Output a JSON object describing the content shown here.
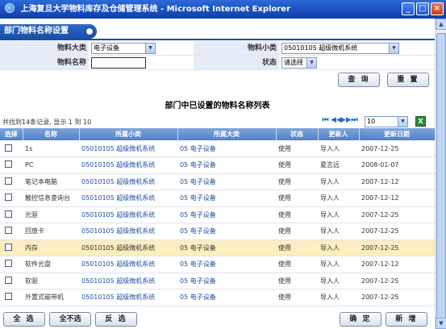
{
  "window": {
    "title": "上海复旦大学物料库存及仓储管理系统 - Microsoft Internet Explorer",
    "minimize": "_",
    "restore": "□",
    "close": "×"
  },
  "section": {
    "title": "部门物料名称设置"
  },
  "filter": {
    "category_label": "物料大类",
    "category_value": "电子设备",
    "subcategory_label": "物料小类",
    "subcategory_value": "05010105 超级微机系统",
    "name_label": "物料名称",
    "name_value": "",
    "status_label": "状态",
    "status_value": "请选择"
  },
  "buttons": {
    "query": "查 询",
    "reset": "重 置",
    "select_all": "全 选",
    "select_none": "全不选",
    "invert": "反 选",
    "confirm": "确 定",
    "add": "新 增"
  },
  "list": {
    "title": "部门中已设置的物料名称列表"
  },
  "pager": {
    "info": "共找到14条记录, 显示 1 到 10",
    "page_size": "10",
    "first": "⏮",
    "prev": "◀◀",
    "next": "▶▶",
    "last": "⏭",
    "export": "X"
  },
  "table": {
    "headers": [
      "选择",
      "名称",
      "所属小类",
      "所属大类",
      "状态",
      "更新人",
      "更新日期"
    ],
    "rows": [
      {
        "name": "1s",
        "sub": "05010105 超级微机系统",
        "cat": "05 电子设备",
        "status": "使用",
        "user": "导入人",
        "date": "2007-12-25"
      },
      {
        "name": "PC",
        "sub": "05010105 超级微机系统",
        "cat": "05 电子设备",
        "status": "使用",
        "user": "夏志远",
        "date": "2008-01-07"
      },
      {
        "name": "笔记本电脑",
        "sub": "05010105 超级微机系统",
        "cat": "05 电子设备",
        "status": "使用",
        "user": "导入人",
        "date": "2007-12-12"
      },
      {
        "name": "触控信息查询台",
        "sub": "05010105 超级微机系统",
        "cat": "05 电子设备",
        "status": "使用",
        "user": "导入人",
        "date": "2007-12-12"
      },
      {
        "name": "光驱",
        "sub": "05010105 超级微机系统",
        "cat": "05 电子设备",
        "status": "使用",
        "user": "导入人",
        "date": "2007-12-25"
      },
      {
        "name": "回放卡",
        "sub": "05010105 超级微机系统",
        "cat": "05 电子设备",
        "status": "使用",
        "user": "导入人",
        "date": "2007-12-25"
      },
      {
        "name": "内存",
        "sub": "05010105 超级微机系统",
        "cat": "05 电子设备",
        "status": "使用",
        "user": "导入人",
        "date": "2007-12-25"
      },
      {
        "name": "软件光盘",
        "sub": "05010105 超级微机系统",
        "cat": "05 电子设备",
        "status": "使用",
        "user": "导入人",
        "date": "2007-12-12"
      },
      {
        "name": "软驱",
        "sub": "05010105 超级微机系统",
        "cat": "05 电子设备",
        "status": "使用",
        "user": "导入人",
        "date": "2007-12-25"
      },
      {
        "name": "外置式磁带机",
        "sub": "05010105 超级微机系统",
        "cat": "05 电子设备",
        "status": "使用",
        "user": "导入人",
        "date": "2007-12-25"
      }
    ]
  },
  "colors": {
    "header_blue": "#1a4ea7",
    "row_highlight": "#fbeec0"
  }
}
